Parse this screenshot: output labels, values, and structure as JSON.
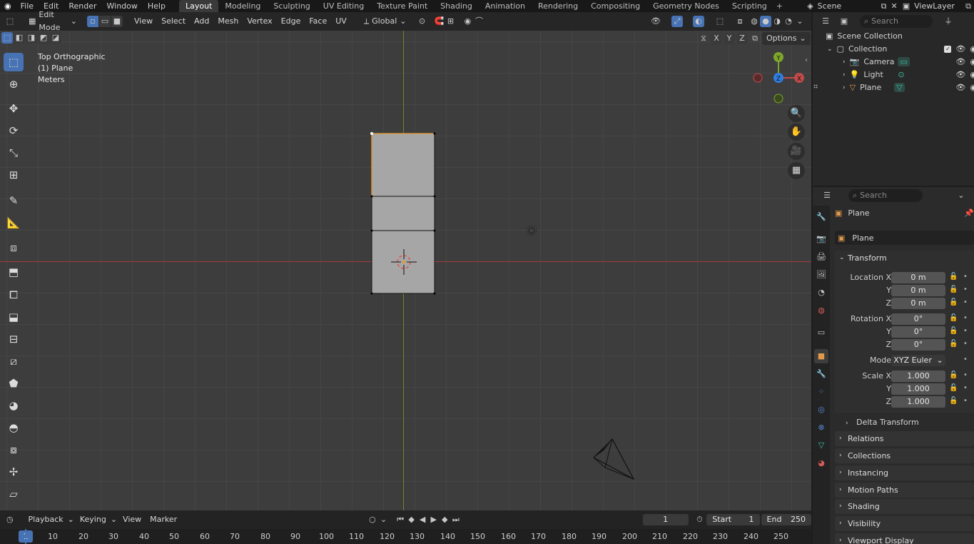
{
  "menu": {
    "items": [
      "File",
      "Edit",
      "Render",
      "Window",
      "Help"
    ],
    "workspaces": [
      "Layout",
      "Modeling",
      "Sculpting",
      "UV Editing",
      "Texture Paint",
      "Shading",
      "Animation",
      "Rendering",
      "Compositing",
      "Geometry Nodes",
      "Scripting"
    ],
    "active_workspace": "Layout",
    "add_tab": "+",
    "scene_name": "Scene",
    "view_layer": "ViewLayer"
  },
  "viewport_header": {
    "mode": "Edit Mode",
    "menus": [
      "View",
      "Select",
      "Add",
      "Mesh",
      "Vertex",
      "Edge",
      "Face",
      "UV"
    ],
    "orientation": "Global",
    "options_label": "Options",
    "axes": [
      "X",
      "Y",
      "Z"
    ]
  },
  "viewport_info": {
    "view": "Top Orthographic",
    "object": "(1) Plane",
    "units": "Meters"
  },
  "gizmo": {
    "x": "X",
    "y": "Y",
    "z": "Z"
  },
  "outliner": {
    "search_placeholder": "Search",
    "root": "Scene Collection",
    "collection": "Collection",
    "objects": [
      "Camera",
      "Light",
      "Plane"
    ]
  },
  "properties": {
    "search_placeholder": "Search",
    "object_name": "Plane",
    "data_name": "Plane",
    "transform_label": "Transform",
    "location_label": "Location X",
    "rotation_label": "Rotation X",
    "scale_label": "Scale X",
    "y_label": "Y",
    "z_label": "Z",
    "location": [
      "0 m",
      "0 m",
      "0 m"
    ],
    "rotation": [
      "0°",
      "0°",
      "0°"
    ],
    "mode_label": "Mode",
    "mode_value": "XYZ Euler",
    "scale": [
      "1.000",
      "1.000",
      "1.000"
    ],
    "delta": "Delta Transform",
    "sections": [
      "Relations",
      "Collections",
      "Instancing",
      "Motion Paths",
      "Shading",
      "Visibility",
      "Viewport Display"
    ]
  },
  "timeline": {
    "menus": [
      "Playback",
      "Keying",
      "View",
      "Marker"
    ],
    "current_frame": "1",
    "start_label": "Start",
    "start": "1",
    "end_label": "End",
    "end": "250",
    "ruler": [
      "1",
      "10",
      "20",
      "30",
      "40",
      "50",
      "60",
      "70",
      "80",
      "90",
      "100",
      "110",
      "120",
      "130",
      "140",
      "150",
      "160",
      "170",
      "180",
      "190",
      "200",
      "210",
      "220",
      "230",
      "240",
      "250"
    ]
  },
  "colors": {
    "accent": "#4772b3",
    "x_axis": "#c14a4a",
    "y_axis": "#7ea62a",
    "z_axis": "#2f7fe0",
    "mesh_face": "#a6a6a6",
    "selected_edge": "#e89a2a"
  }
}
